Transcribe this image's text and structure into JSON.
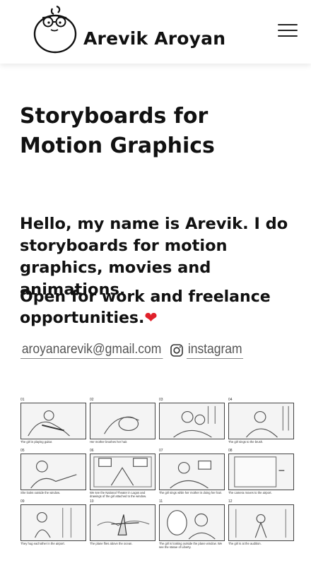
{
  "header": {
    "site_name": "Arevik Aroyan",
    "logo_icon": "cartoon-face-logo",
    "menu_icon": "hamburger-menu-icon"
  },
  "page": {
    "title": "Storyboards for Motion Graphics",
    "intro": "Hello, my name is Arevik. I do storyboards for motion graphics, movies and animations.",
    "open_for_work": "Open for work and freelance opportunities.",
    "heart": "❤"
  },
  "contacts": {
    "email": "aroyanarevik@gmail.com",
    "instagram_icon": "instagram-icon",
    "instagram": "instagram"
  },
  "storyboard": {
    "panels": [
      {
        "num": "01",
        "caption": "The girl is playing guitar."
      },
      {
        "num": "02",
        "caption": "Her mother brushes her hair."
      },
      {
        "num": "03",
        "caption": ""
      },
      {
        "num": "04",
        "caption": "The girl sings to the brush."
      },
      {
        "num": "05",
        "caption": "She looks outside the window."
      },
      {
        "num": "06",
        "caption": "We see the National Theater in Lagos and drawings of the girl attached to the window."
      },
      {
        "num": "07",
        "caption": "The girl sings while her mother is doing her hair."
      },
      {
        "num": "08",
        "caption": "The camera moves to the airport."
      },
      {
        "num": "09",
        "caption": "They hug eachother in the airport."
      },
      {
        "num": "10",
        "caption": "The plane flies above the ocean."
      },
      {
        "num": "11",
        "caption": "The girl is looking outside the plane window. We see the statue of Liberty."
      },
      {
        "num": "12",
        "caption": "The girl is at the audition."
      }
    ]
  }
}
